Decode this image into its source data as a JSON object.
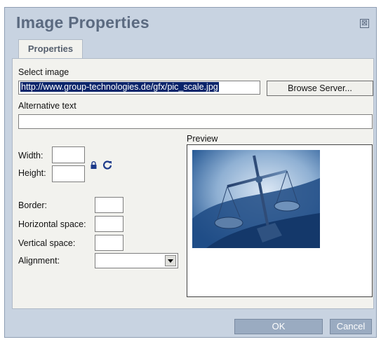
{
  "dialog": {
    "title": "Image Properties",
    "close_glyph": "⊠"
  },
  "tabs": [
    {
      "label": "Properties"
    }
  ],
  "form": {
    "select_image_label": "Select image",
    "url_value": "http://www.group-technologies.de/gfx/pic_scale.jpg",
    "browse_label": "Browse Server...",
    "alt_text_label": "Alternative text",
    "alt_text_value": "",
    "width_label": "Width:",
    "height_label": "Height:",
    "border_label": "Border:",
    "hspace_label": "Horizontal space:",
    "vspace_label": "Vertical space:",
    "alignment_label": "Alignment:",
    "alignment_value": ""
  },
  "preview": {
    "label": "Preview"
  },
  "footer": {
    "ok_label": "OK",
    "cancel_label": "Cancel"
  },
  "icons": [
    "lock-icon",
    "refresh-icon",
    "close-icon",
    "chevron-down-icon"
  ],
  "colors": {
    "dialog_bg": "#c8d3e1",
    "title": "#5b6a80",
    "panel_bg": "#f2f2ee",
    "selection": "#0a246a"
  }
}
